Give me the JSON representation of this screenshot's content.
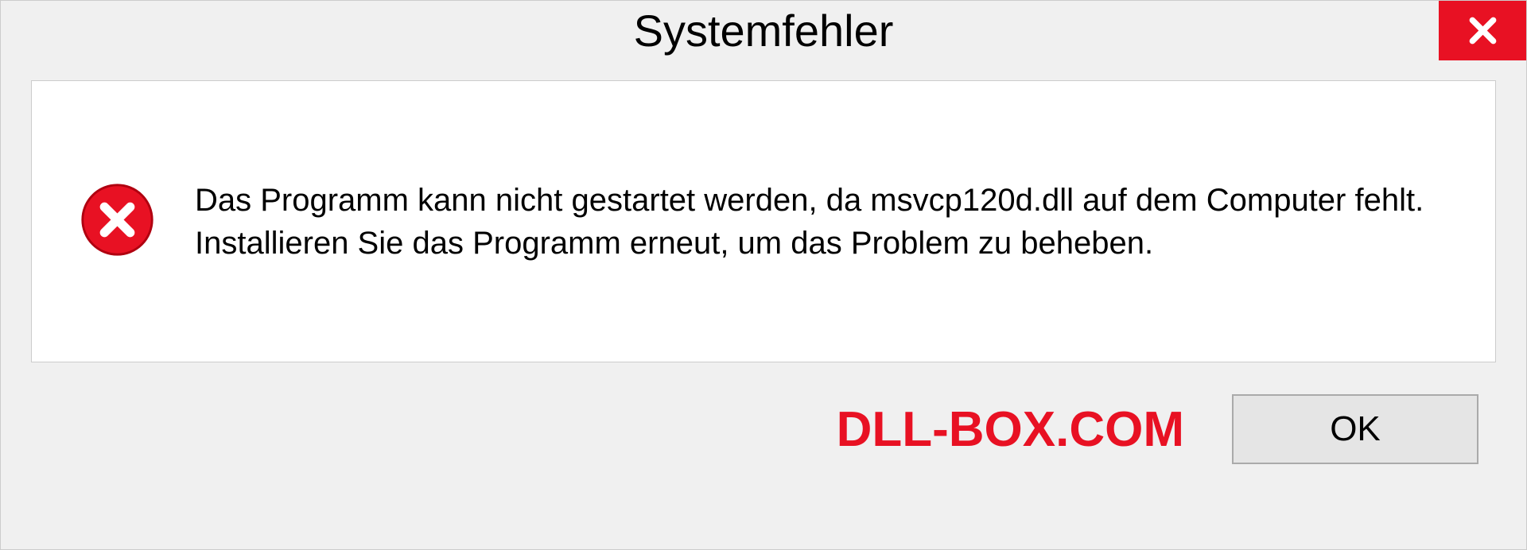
{
  "dialog": {
    "title": "Systemfehler",
    "message": "Das Programm kann nicht gestartet werden, da msvcp120d.dll auf dem Computer fehlt. Installieren Sie das Programm erneut, um das Problem zu beheben.",
    "ok_label": "OK"
  },
  "watermark": "DLL-BOX.COM"
}
